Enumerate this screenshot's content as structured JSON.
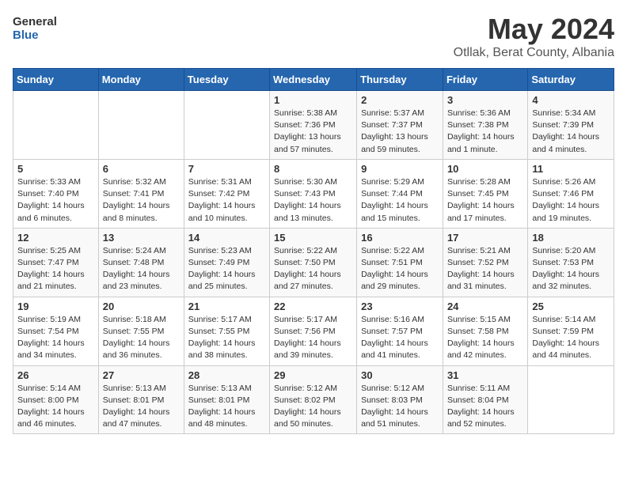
{
  "header": {
    "logo_general": "General",
    "logo_blue": "Blue",
    "month_title": "May 2024",
    "location": "Otllak, Berat County, Albania"
  },
  "days_of_week": [
    "Sunday",
    "Monday",
    "Tuesday",
    "Wednesday",
    "Thursday",
    "Friday",
    "Saturday"
  ],
  "weeks": [
    [
      {
        "day": "",
        "info": ""
      },
      {
        "day": "",
        "info": ""
      },
      {
        "day": "",
        "info": ""
      },
      {
        "day": "1",
        "info": "Sunrise: 5:38 AM\nSunset: 7:36 PM\nDaylight: 13 hours\nand 57 minutes."
      },
      {
        "day": "2",
        "info": "Sunrise: 5:37 AM\nSunset: 7:37 PM\nDaylight: 13 hours\nand 59 minutes."
      },
      {
        "day": "3",
        "info": "Sunrise: 5:36 AM\nSunset: 7:38 PM\nDaylight: 14 hours\nand 1 minute."
      },
      {
        "day": "4",
        "info": "Sunrise: 5:34 AM\nSunset: 7:39 PM\nDaylight: 14 hours\nand 4 minutes."
      }
    ],
    [
      {
        "day": "5",
        "info": "Sunrise: 5:33 AM\nSunset: 7:40 PM\nDaylight: 14 hours\nand 6 minutes."
      },
      {
        "day": "6",
        "info": "Sunrise: 5:32 AM\nSunset: 7:41 PM\nDaylight: 14 hours\nand 8 minutes."
      },
      {
        "day": "7",
        "info": "Sunrise: 5:31 AM\nSunset: 7:42 PM\nDaylight: 14 hours\nand 10 minutes."
      },
      {
        "day": "8",
        "info": "Sunrise: 5:30 AM\nSunset: 7:43 PM\nDaylight: 14 hours\nand 13 minutes."
      },
      {
        "day": "9",
        "info": "Sunrise: 5:29 AM\nSunset: 7:44 PM\nDaylight: 14 hours\nand 15 minutes."
      },
      {
        "day": "10",
        "info": "Sunrise: 5:28 AM\nSunset: 7:45 PM\nDaylight: 14 hours\nand 17 minutes."
      },
      {
        "day": "11",
        "info": "Sunrise: 5:26 AM\nSunset: 7:46 PM\nDaylight: 14 hours\nand 19 minutes."
      }
    ],
    [
      {
        "day": "12",
        "info": "Sunrise: 5:25 AM\nSunset: 7:47 PM\nDaylight: 14 hours\nand 21 minutes."
      },
      {
        "day": "13",
        "info": "Sunrise: 5:24 AM\nSunset: 7:48 PM\nDaylight: 14 hours\nand 23 minutes."
      },
      {
        "day": "14",
        "info": "Sunrise: 5:23 AM\nSunset: 7:49 PM\nDaylight: 14 hours\nand 25 minutes."
      },
      {
        "day": "15",
        "info": "Sunrise: 5:22 AM\nSunset: 7:50 PM\nDaylight: 14 hours\nand 27 minutes."
      },
      {
        "day": "16",
        "info": "Sunrise: 5:22 AM\nSunset: 7:51 PM\nDaylight: 14 hours\nand 29 minutes."
      },
      {
        "day": "17",
        "info": "Sunrise: 5:21 AM\nSunset: 7:52 PM\nDaylight: 14 hours\nand 31 minutes."
      },
      {
        "day": "18",
        "info": "Sunrise: 5:20 AM\nSunset: 7:53 PM\nDaylight: 14 hours\nand 32 minutes."
      }
    ],
    [
      {
        "day": "19",
        "info": "Sunrise: 5:19 AM\nSunset: 7:54 PM\nDaylight: 14 hours\nand 34 minutes."
      },
      {
        "day": "20",
        "info": "Sunrise: 5:18 AM\nSunset: 7:55 PM\nDaylight: 14 hours\nand 36 minutes."
      },
      {
        "day": "21",
        "info": "Sunrise: 5:17 AM\nSunset: 7:55 PM\nDaylight: 14 hours\nand 38 minutes."
      },
      {
        "day": "22",
        "info": "Sunrise: 5:17 AM\nSunset: 7:56 PM\nDaylight: 14 hours\nand 39 minutes."
      },
      {
        "day": "23",
        "info": "Sunrise: 5:16 AM\nSunset: 7:57 PM\nDaylight: 14 hours\nand 41 minutes."
      },
      {
        "day": "24",
        "info": "Sunrise: 5:15 AM\nSunset: 7:58 PM\nDaylight: 14 hours\nand 42 minutes."
      },
      {
        "day": "25",
        "info": "Sunrise: 5:14 AM\nSunset: 7:59 PM\nDaylight: 14 hours\nand 44 minutes."
      }
    ],
    [
      {
        "day": "26",
        "info": "Sunrise: 5:14 AM\nSunset: 8:00 PM\nDaylight: 14 hours\nand 46 minutes."
      },
      {
        "day": "27",
        "info": "Sunrise: 5:13 AM\nSunset: 8:01 PM\nDaylight: 14 hours\nand 47 minutes."
      },
      {
        "day": "28",
        "info": "Sunrise: 5:13 AM\nSunset: 8:01 PM\nDaylight: 14 hours\nand 48 minutes."
      },
      {
        "day": "29",
        "info": "Sunrise: 5:12 AM\nSunset: 8:02 PM\nDaylight: 14 hours\nand 50 minutes."
      },
      {
        "day": "30",
        "info": "Sunrise: 5:12 AM\nSunset: 8:03 PM\nDaylight: 14 hours\nand 51 minutes."
      },
      {
        "day": "31",
        "info": "Sunrise: 5:11 AM\nSunset: 8:04 PM\nDaylight: 14 hours\nand 52 minutes."
      },
      {
        "day": "",
        "info": ""
      }
    ]
  ]
}
